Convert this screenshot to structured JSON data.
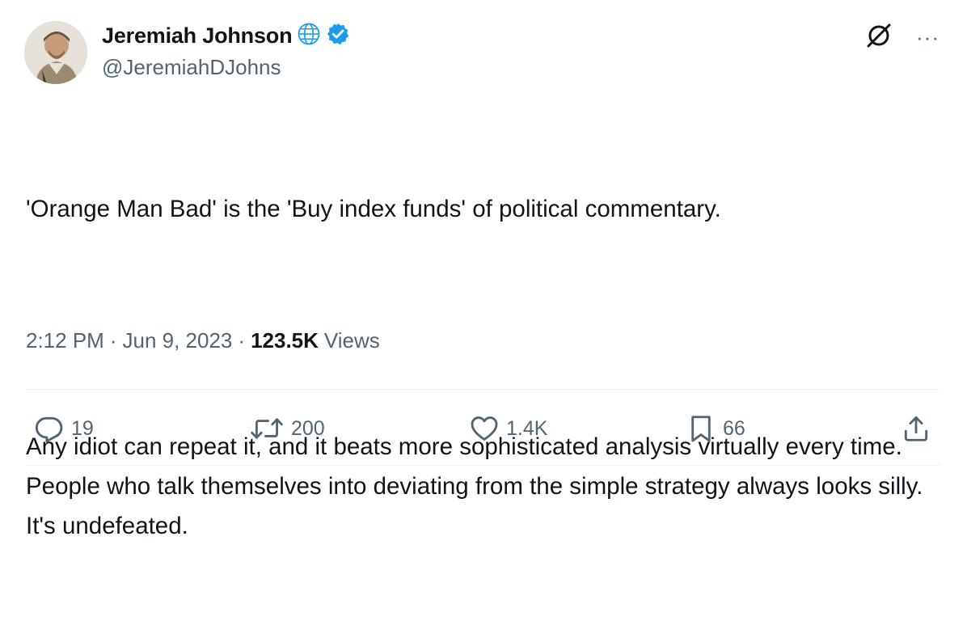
{
  "author": {
    "name": "Jeremiah Johnson",
    "handle": "@JeremiahDJohns",
    "badges": [
      "globe-icon",
      "verified-badge-icon"
    ],
    "verified_color": "#1d9bf0"
  },
  "header_actions": {
    "grok_icon": "grok-icon",
    "more_label": "···"
  },
  "tweet": {
    "paragraph_1": "'Orange Man Bad' is the 'Buy index funds' of political commentary.",
    "paragraph_2": "Any idiot can repeat it, and it beats more sophisticated analysis virtually every time. People who talk themselves into deviating from the simple strategy always looks silly. It's undefeated."
  },
  "meta": {
    "time": "2:12 PM",
    "separator": "·",
    "date": "Jun 9, 2023",
    "views_count": "123.5K",
    "views_label": "Views"
  },
  "actions": {
    "replies": "19",
    "retweets": "200",
    "likes": "1.4K",
    "bookmarks": "66"
  },
  "colors": {
    "text_primary": "#0f1419",
    "text_secondary": "#536471",
    "accent": "#1d9bf0",
    "divider": "#eff3f4"
  }
}
